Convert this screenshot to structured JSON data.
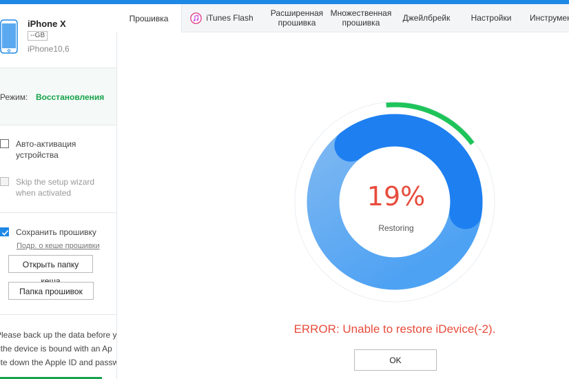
{
  "device": {
    "name": "iPhone X",
    "storage": "--GB",
    "model": "iPhone10,6"
  },
  "mode": {
    "label": "Режим:",
    "value": "Восстановления"
  },
  "options": {
    "auto_activation": {
      "label": "Авто-активация устройства",
      "checked": false
    },
    "skip_wizard": {
      "label": "Skip the setup wizard when activated",
      "checked": false,
      "disabled": true
    },
    "save_firmware": {
      "label": "Сохранить прошивку",
      "checked": true
    }
  },
  "cache_link": "Подр. о кеше прошивки",
  "buttons": {
    "open_cache": "Открыть папку кеша",
    "firmware_folder": "Папка прошивок",
    "ok": "OK"
  },
  "notice": [
    "Please back up the data before yo",
    "f the device is bound with an Ap",
    "ote down the Apple ID and passw"
  ],
  "tabs": [
    {
      "label": "Прошивка",
      "active": true
    },
    {
      "label": "iTunes Flash",
      "icon": "itunes-icon"
    },
    {
      "label": "Расширенная прошивка"
    },
    {
      "label": "Множественная прошивка"
    },
    {
      "label": "Джейлбрейк"
    },
    {
      "label": "Настройки"
    },
    {
      "label": "Инструмен"
    }
  ],
  "progress": {
    "percent_text": "19%",
    "value": 19,
    "status": "Restoring"
  },
  "error": "ERROR: Unable to restore iDevice(-2).",
  "colors": {
    "accent": "#1e88e5",
    "success": "#16a34a",
    "error": "#e74c3c"
  }
}
